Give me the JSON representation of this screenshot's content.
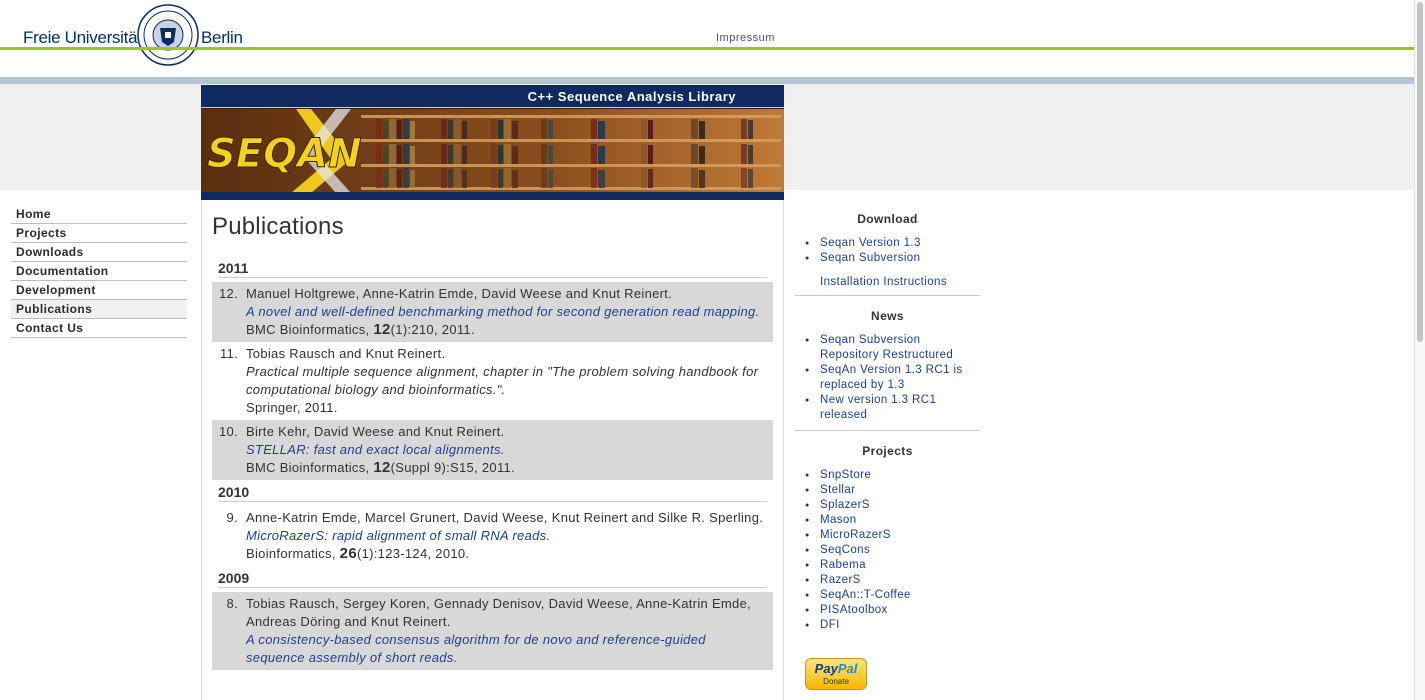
{
  "header": {
    "brand_left": "Freie Universität",
    "brand_right": "Berlin",
    "impressum_label": "Impressum"
  },
  "banner": {
    "tagline": "C++ Sequence Analysis Library",
    "logo_text": "SEQAN"
  },
  "nav": {
    "items": [
      {
        "label": "Home",
        "active": false
      },
      {
        "label": "Projects",
        "active": false
      },
      {
        "label": "Downloads",
        "active": false
      },
      {
        "label": "Documentation",
        "active": false
      },
      {
        "label": "Development",
        "active": false
      },
      {
        "label": "Publications",
        "active": true
      },
      {
        "label": "Contact Us",
        "active": false
      }
    ]
  },
  "main": {
    "title": "Publications",
    "years": [
      "2011",
      "2010",
      "2009"
    ],
    "pubs": [
      {
        "num": "12.",
        "authors": "Manuel Holtgrewe, Anne-Katrin Emde, David Weese and Knut Reinert.",
        "title": "A novel and well-defined benchmarking method for second generation read mapping.",
        "src_pre": "BMC Bioinformatics, ",
        "src_vol": "12",
        "src_post": "(1):210, 2011."
      },
      {
        "num": "11.",
        "authors": "Tobias Rausch and Knut Reinert.",
        "title": "Practical multiple sequence alignment, chapter in \"The problem solving handbook for computational biology and bioinformatics.\".",
        "src_pre": "Springer, 2011.",
        "src_vol": "",
        "src_post": ""
      },
      {
        "num": "10.",
        "authors": "Birte Kehr, David Weese and Knut Reinert.",
        "title": "STELLAR: fast and exact local alignments.",
        "src_pre": "BMC Bioinformatics, ",
        "src_vol": "12",
        "src_post": "(Suppl 9):S15, 2011."
      },
      {
        "num": "9.",
        "authors": "Anne-Katrin Emde, Marcel Grunert, David Weese, Knut Reinert and Silke R. Sperling.",
        "title": "MicroRazerS: rapid alignment of small RNA reads.",
        "src_pre": "Bioinformatics, ",
        "src_vol": "26",
        "src_post": "(1):123-124, 2010."
      },
      {
        "num": "8.",
        "authors": "Tobias Rausch, Sergey Koren, Gennady Denisov, David Weese, Anne-Katrin Emde, Andreas Döring and Knut Reinert.",
        "title": "A consistency-based consensus algorithm for de novo and reference-guided sequence assembly of short reads."
      }
    ]
  },
  "sidebar": {
    "download": {
      "title": "Download",
      "items": [
        "Seqan Version 1.3",
        "Seqan Subversion"
      ],
      "extra": "Installation Instructions"
    },
    "news": {
      "title": "News",
      "items": [
        "Seqan Subversion Repository Restructured",
        "SeqAn Version 1.3 RC1 is replaced by 1.3",
        "New version 1.3 RC1 released"
      ]
    },
    "projects": {
      "title": "Projects",
      "items": [
        "SnpStore",
        "Stellar",
        "SplazerS",
        "Mason",
        "MicroRazerS",
        "SeqCons",
        "Rabema",
        "RazerS",
        "SeqAn::T-Coffee",
        "PISAtoolbox",
        "DFI"
      ]
    },
    "paypal": {
      "brand_a": "Pay",
      "brand_b": "Pal",
      "label": "Donate"
    }
  },
  "colors": {
    "green_rule": "#99cc00",
    "blue_rule": "#b6c4d6",
    "link": "#1f3f8f",
    "banner_bar": "#0e2a5e"
  }
}
